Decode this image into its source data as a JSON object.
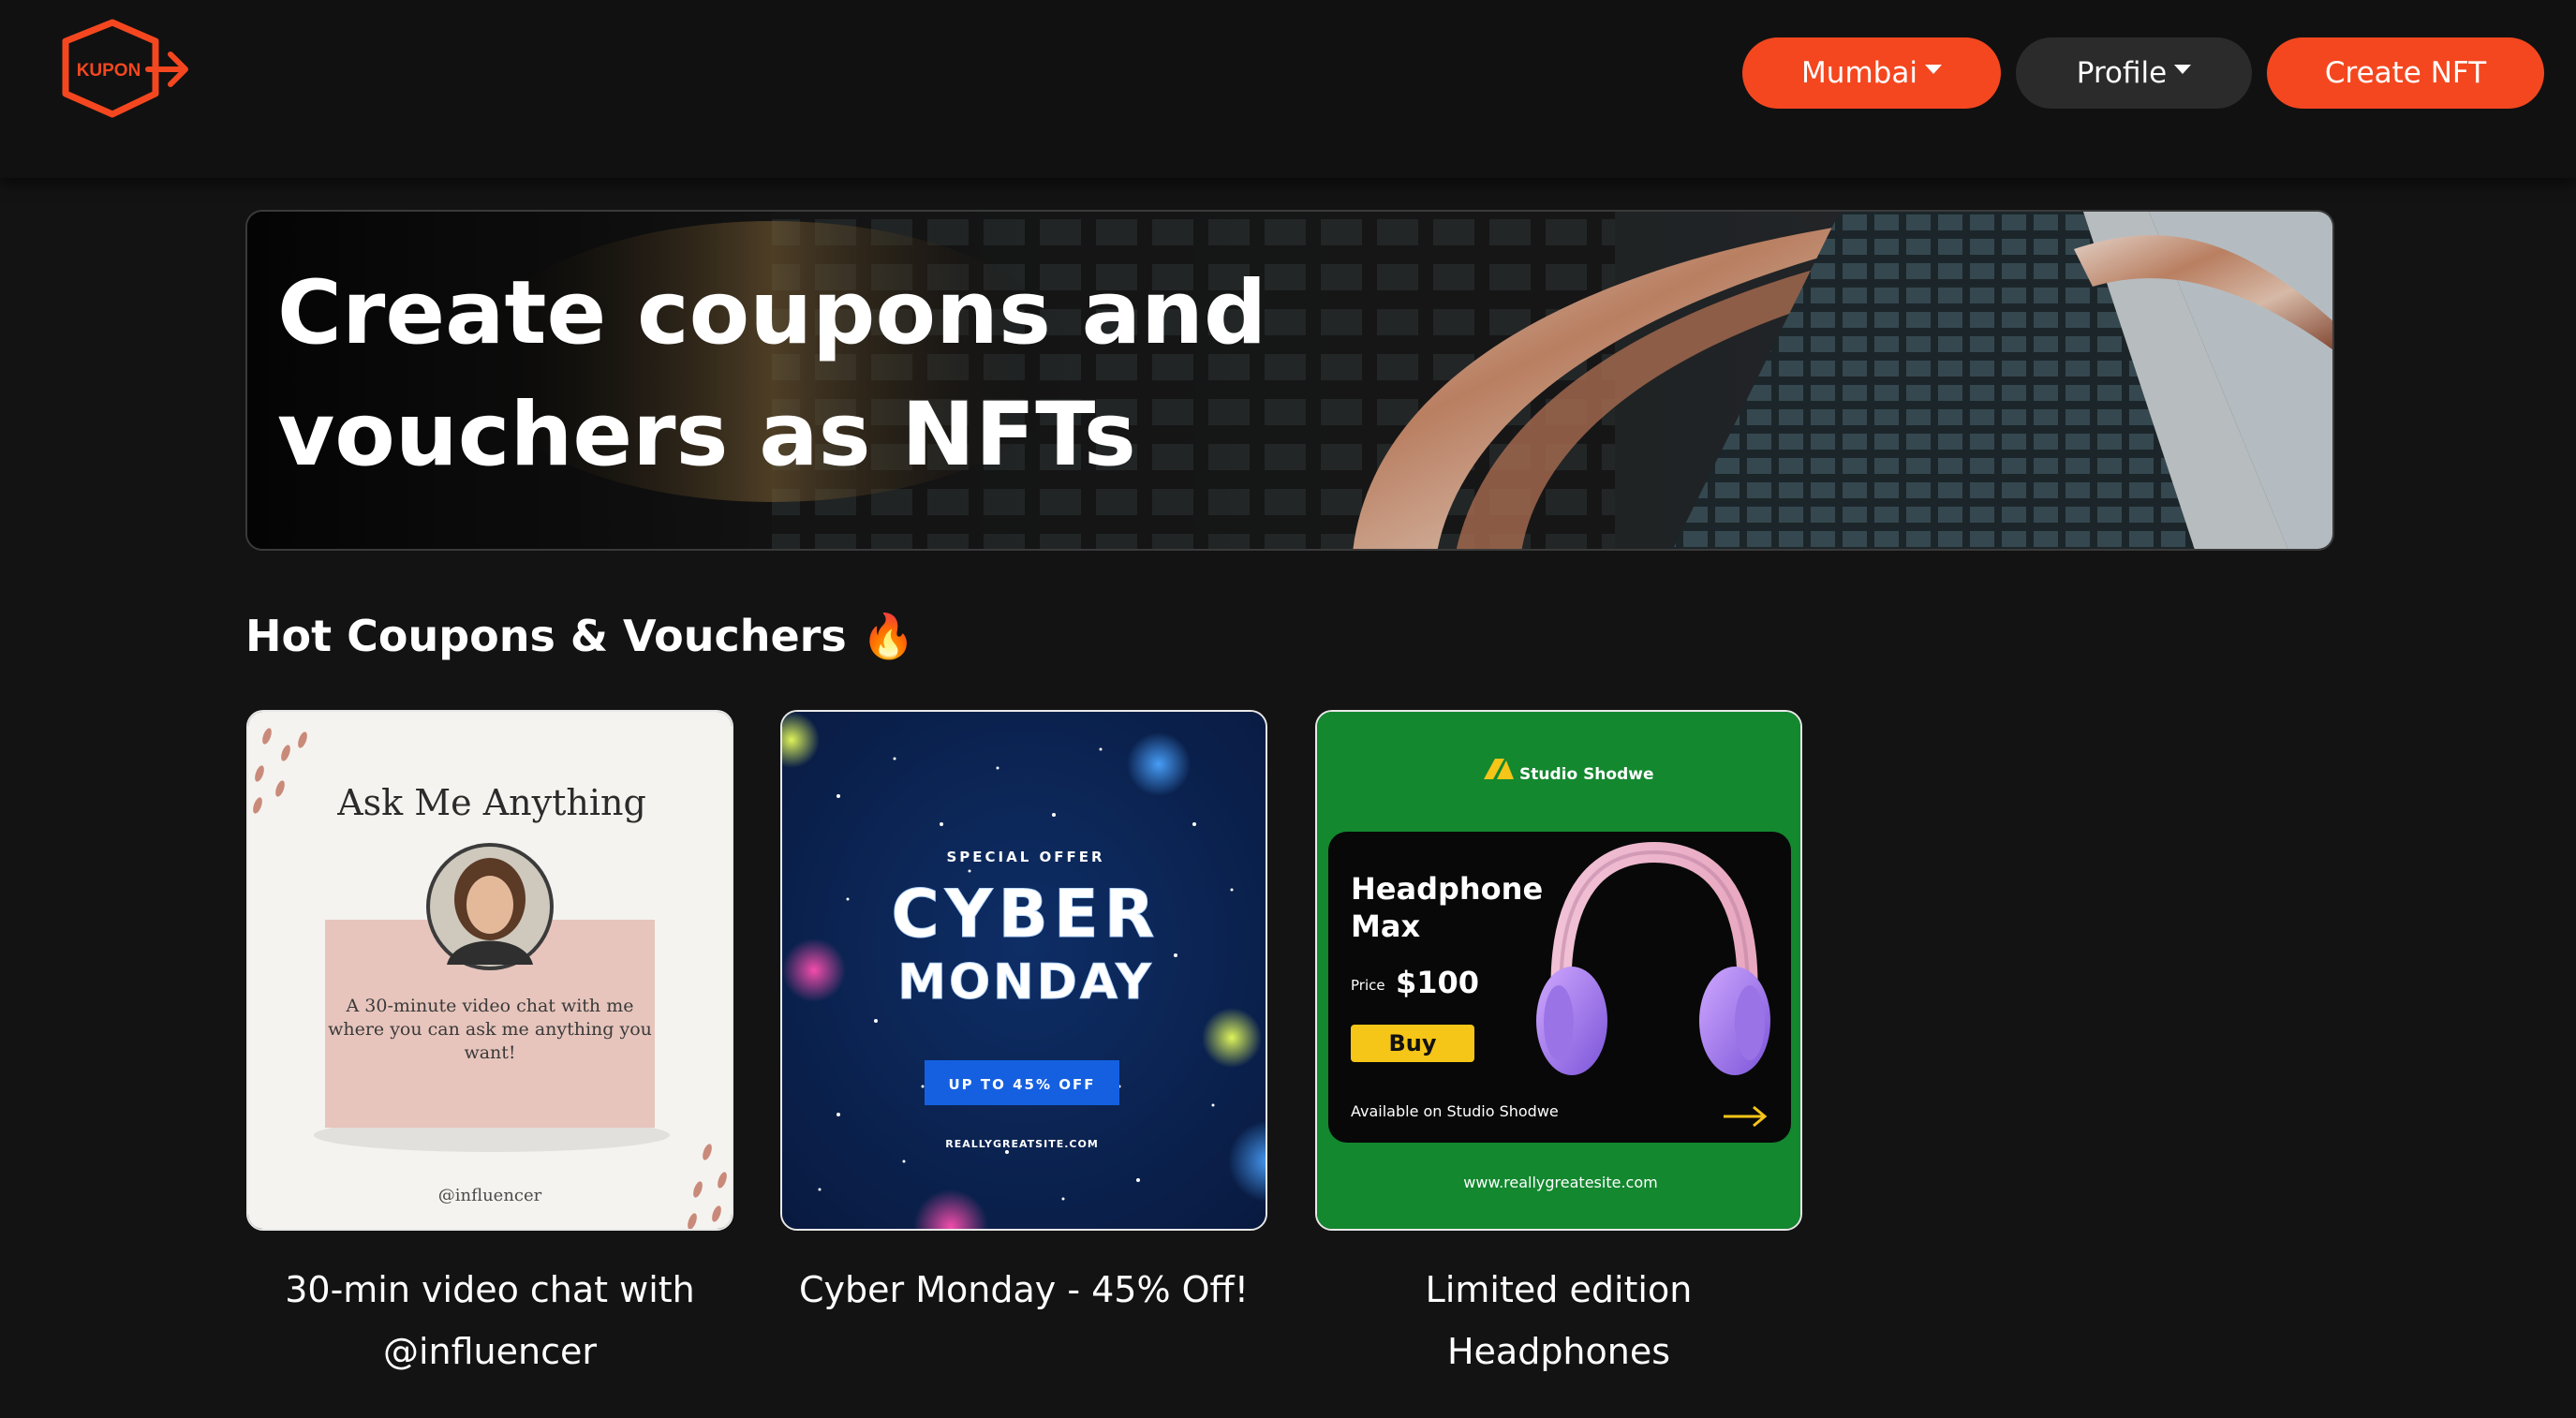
{
  "brand": {
    "logo_text": "KUPON"
  },
  "nav": {
    "city_label": "Mumbai",
    "profile_label": "Profile",
    "create_label": "Create NFT"
  },
  "hero": {
    "title_line1": "Create coupons and",
    "title_line2": "vouchers as NFTs"
  },
  "section": {
    "title": "Hot Coupons & Vouchers 🔥"
  },
  "cards": [
    {
      "caption": "30-min video chat with @influencer",
      "image": {
        "heading": "Ask Me Anything",
        "desc_line1": "A 30-minute video chat with me",
        "desc_line2": "where you can ask me anything you",
        "desc_line3": "want!",
        "handle": "@influencer"
      }
    },
    {
      "caption": "Cyber Monday - 45% Off!",
      "image": {
        "kicker": "SPECIAL OFFER",
        "line1": "CYBER",
        "line2": "MONDAY",
        "badge": "UP TO 45% OFF",
        "site": "REALLYGREATSITE.COM"
      }
    },
    {
      "caption": "Limited edition Headphones",
      "image": {
        "brand": "Studio Shodwe",
        "product_line1": "Headphone",
        "product_line2": "Max",
        "price_label": "Price",
        "price": "$100",
        "buy_label": "Buy",
        "availability": "Available on Studio Shodwe",
        "site": "www.reallygreatesite.com"
      }
    }
  ],
  "colors": {
    "accent": "#f4471f",
    "background": "#131313",
    "navbar": "#111111",
    "profile_button": "#2b2b2b"
  }
}
